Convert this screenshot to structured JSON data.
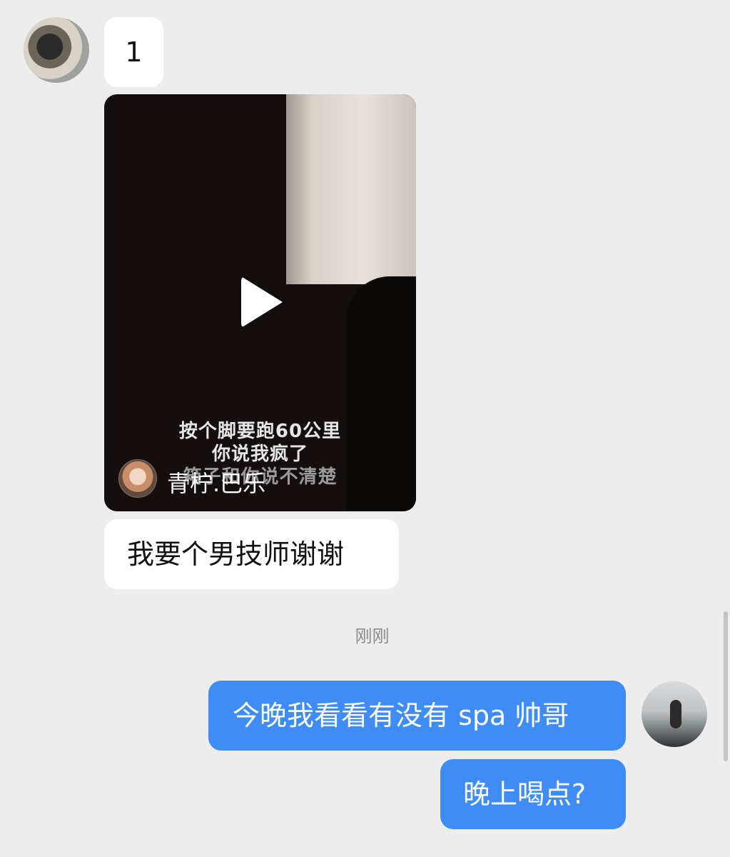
{
  "messages": {
    "incoming_1": "1",
    "video": {
      "caption_line1": "按个脚要跑60公里",
      "caption_line2": "你说我疯了",
      "caption_line3": "箱子和你说不清楚",
      "author_name": "青柠.巴乐"
    },
    "incoming_2": "我要个男技师谢谢",
    "timestamp": "刚刚",
    "outgoing_1": "今晚我看看有没有 spa 帅哥",
    "outgoing_2": "晚上喝点?"
  },
  "colors": {
    "background": "#ededed",
    "incoming_bubble": "#ffffff",
    "outgoing_bubble": "#3f8cf7"
  }
}
